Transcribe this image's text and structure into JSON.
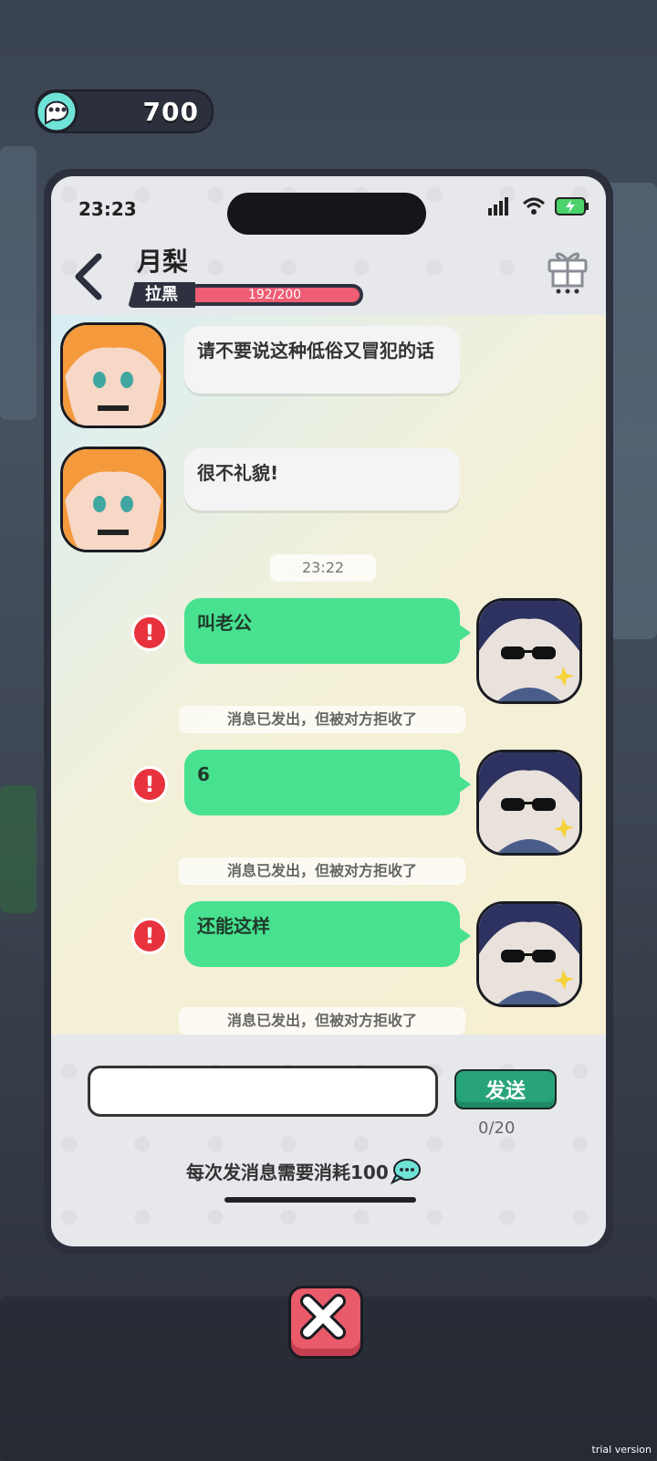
{
  "currency": {
    "value": "700"
  },
  "phone": {
    "status_time": "23:23",
    "contact_name": "月梨",
    "relationship": {
      "label": "拉黑",
      "text": "192/200",
      "progress": 0.96
    }
  },
  "chat": {
    "messages": [
      {
        "side": "left",
        "text": "请不要说这种低俗又冒犯的话"
      },
      {
        "side": "left",
        "text": "很不礼貌!"
      },
      {
        "type": "timestamp",
        "text": "23:22"
      },
      {
        "side": "right",
        "text": "叫老公",
        "status": "消息已发出，但被对方拒收了"
      },
      {
        "side": "right",
        "text": "6",
        "status": "消息已发出，但被对方拒收了"
      },
      {
        "side": "right",
        "text": "还能这样",
        "status": "消息已发出，但被对方拒收了"
      }
    ]
  },
  "composer": {
    "input_value": "",
    "send_label": "发送",
    "counter": "0/20",
    "cost_text": "每次发消息需要消耗100"
  },
  "footer": {
    "watermark": "trial version"
  },
  "colors": {
    "accent_green": "#48e190",
    "error_red": "#e8323e",
    "bar_pink": "#ef5d74"
  }
}
